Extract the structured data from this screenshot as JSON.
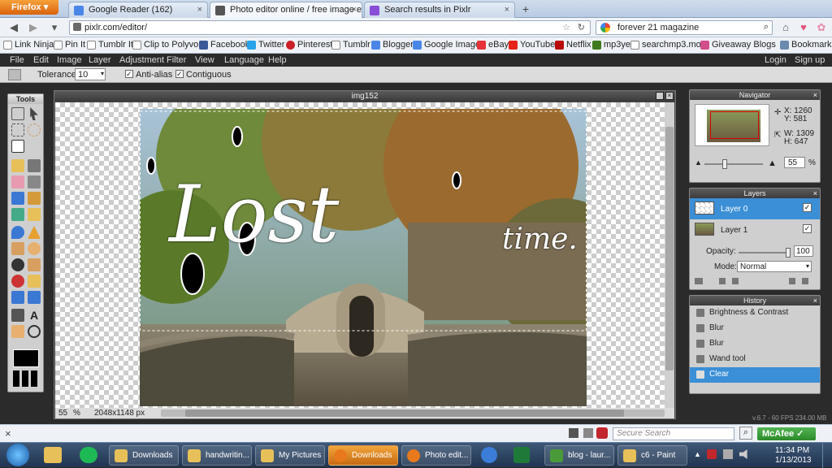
{
  "browser": {
    "menu_button": "Firefox",
    "tabs": [
      {
        "label": "Google Reader (162)",
        "color": "#4a86e8"
      },
      {
        "label": "Photo editor online / free image editi...",
        "color": "#555555"
      },
      {
        "label": "Search results in Pixlr",
        "color": "#8a4bd6"
      }
    ],
    "new_tab": "+",
    "url": "pixlr.com/editor/",
    "search": "forever 21 magazine"
  },
  "bookmarks": [
    {
      "label": "Link Ninja",
      "color": "#ffffff"
    },
    {
      "label": "Pin It",
      "color": "#ffffff"
    },
    {
      "label": "Tumblr It",
      "color": "#ffffff"
    },
    {
      "label": "Clip to Polyvore",
      "color": "#ffffff"
    },
    {
      "label": "Facebook",
      "color": "#3b5998"
    },
    {
      "label": "Twitter",
      "color": "#2aa3e8"
    },
    {
      "label": "Pinterest",
      "color": "#cb2027"
    },
    {
      "label": "Tumblr",
      "color": "#34526f"
    },
    {
      "label": "Blogger",
      "color": "#f57d00"
    },
    {
      "label": "Google Images",
      "color": "#4a86e8"
    },
    {
      "label": "eBay",
      "color": "#e53238"
    },
    {
      "label": "YouTube",
      "color": "#e62117"
    },
    {
      "label": "Netflix",
      "color": "#b9090b"
    },
    {
      "label": "mp3ye",
      "color": "#3d7a1f"
    },
    {
      "label": "searchmp3.mobi",
      "color": "#ffffff"
    },
    {
      "label": "Giveaway Blogs",
      "color": "#d14e8a"
    }
  ],
  "bookmarks_menu": "Bookmarks",
  "pixlr": {
    "menus": [
      "File",
      "Edit",
      "Image",
      "Layer",
      "Adjustment",
      "Filter",
      "View",
      "Language",
      "Help"
    ],
    "login": "Login",
    "signup": "Sign up",
    "options": {
      "tolerance_label": "Tolerance:",
      "tolerance_value": "10",
      "antialias_label": "Anti-alias",
      "contiguous_label": "Contiguous"
    },
    "tools_title": "Tools",
    "canvas_title": "img152",
    "overlay_text": [
      "Lost",
      "time."
    ],
    "status": {
      "zoom": "55",
      "zoom_unit": "%",
      "size": "2048x1148 px"
    },
    "navigator": {
      "title": "Navigator",
      "x": "X: 1260",
      "y": "Y:  581",
      "w": "W: 1309",
      "h": "H:  647",
      "zoom": "55",
      "zoom_unit": "%"
    },
    "layers": {
      "title": "Layers",
      "items": [
        {
          "name": "Layer 0",
          "selected": true
        },
        {
          "name": "Layer 1",
          "selected": false
        }
      ],
      "opacity_label": "Opacity:",
      "opacity_value": "100",
      "mode_label": "Mode:",
      "mode_value": "Normal"
    },
    "history": {
      "title": "History",
      "items": [
        "Brightness & Contrast",
        "Blur",
        "Blur",
        "Wand tool",
        "Clear"
      ]
    },
    "version": "v.6.7 - 60 FPS 234.00 MB"
  },
  "findbar": {
    "close": "×",
    "search_placeholder": "Secure Search",
    "mcafee": "McAfee"
  },
  "taskbar": {
    "items": [
      {
        "label": "Downloads",
        "color": "#e8c05a",
        "hot": false
      },
      {
        "label": "handwritin...",
        "color": "#e8c05a",
        "hot": false
      },
      {
        "label": "My Pictures",
        "color": "#e8c05a",
        "hot": false
      },
      {
        "label": "Downloads",
        "color": "#e8791d",
        "hot": true
      },
      {
        "label": "Photo edit...",
        "color": "#e8791d",
        "hot": false
      },
      {
        "label": "blog - laur...",
        "color": "#4a9a3a",
        "hot": false
      },
      {
        "label": "c6 - Paint",
        "color": "#e8c05a",
        "hot": false
      }
    ],
    "time": "11:34 PM",
    "date": "1/13/2013"
  }
}
